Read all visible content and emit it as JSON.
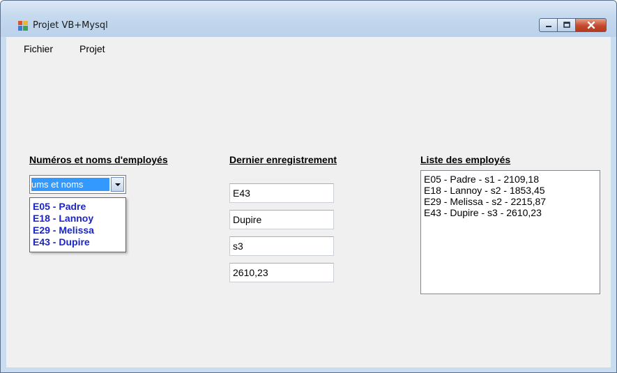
{
  "window": {
    "title": "Projet VB+Mysql"
  },
  "menu": {
    "items": [
      {
        "label": "Fichier"
      },
      {
        "label": "Projet"
      }
    ]
  },
  "employee_combo": {
    "heading": "Numéros et noms d'employés",
    "selected_text": "ums et noms",
    "options": [
      "E05 - Padre",
      "E18 - Lannoy",
      "E29 - Melissa",
      "E43 - Dupire"
    ]
  },
  "last_record": {
    "heading": "Dernier enregistrement",
    "fields": [
      "E43",
      "Dupire",
      "s3",
      "2610,23"
    ]
  },
  "employee_list": {
    "heading": "Liste des employés",
    "rows": [
      "E05 - Padre - s1 - 2109,18",
      "E18 - Lannoy - s2 - 1853,45",
      "E29 - Melissa - s2 - 2215,87",
      "E43 - Dupire - s3 - 2610,23"
    ]
  },
  "colors": {
    "selection": "#3399ff",
    "dropdown_text": "#1a24c8",
    "close_button": "#c44a2d"
  }
}
